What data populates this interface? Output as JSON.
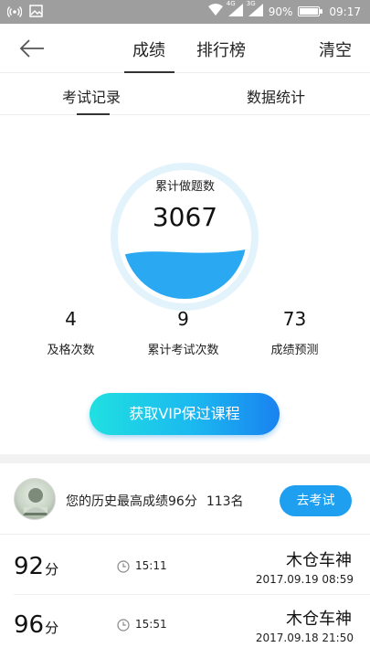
{
  "status_bar": {
    "network_4g": "4G",
    "network_3g": "3G",
    "battery_percent": "90%",
    "battery_level": 0.9,
    "time": "09:17"
  },
  "header": {
    "tabs": [
      {
        "label": "成绩",
        "active": true
      },
      {
        "label": "排行榜",
        "active": false
      }
    ],
    "clear_label": "清空"
  },
  "sub_tabs": [
    {
      "label": "考试记录",
      "active": true
    },
    {
      "label": "数据统计",
      "active": false
    }
  ],
  "stats": {
    "gauge_label": "累计做题数",
    "gauge_value": "3067",
    "gauge_fill": 0.38,
    "metrics": [
      {
        "value": "4",
        "label": "及格次数"
      },
      {
        "value": "9",
        "label": "累计考试次数"
      },
      {
        "value": "73",
        "label": "成绩预测"
      }
    ],
    "vip_button": "获取VIP保过课程"
  },
  "history": {
    "text": "您的历史最高成绩96分",
    "rank": "113名",
    "exam_button": "去考试"
  },
  "records": [
    {
      "score": "92",
      "unit": "分",
      "duration": "15:11",
      "name": "木仓车神",
      "date": "2017.09.19  08:59"
    },
    {
      "score": "96",
      "unit": "分",
      "duration": "15:51",
      "name": "木仓车神",
      "date": "2017.09.18  21:50"
    }
  ],
  "colors": {
    "accent": "#1f9ff0",
    "wave": "#2aa8f2",
    "ring": "#e3f3fc"
  }
}
